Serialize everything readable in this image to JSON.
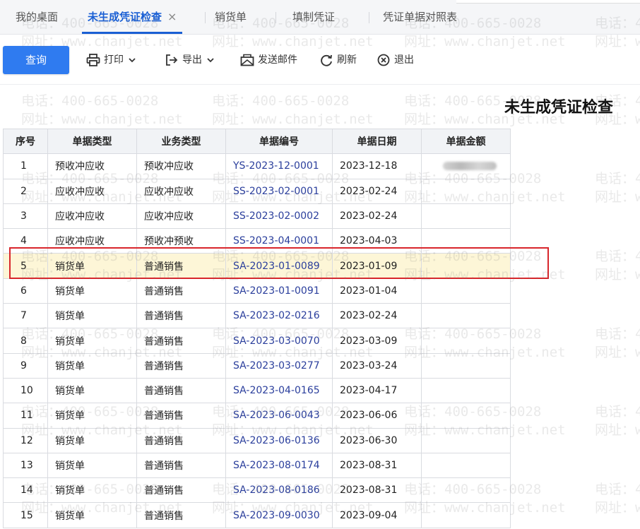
{
  "tabs": [
    {
      "label": "我的桌面"
    },
    {
      "label": "未生成凭证检查",
      "close": "×"
    },
    {
      "label": "销货单"
    },
    {
      "label": "填制凭证"
    },
    {
      "label": "凭证单据对照表"
    }
  ],
  "toolbar": {
    "query": "查询",
    "print": "打印",
    "export": "导出",
    "email": "发送邮件",
    "refresh": "刷新",
    "exit": "退出"
  },
  "page_title": "未生成凭证检查",
  "table": {
    "columns": [
      "序号",
      "单据类型",
      "业务类型",
      "单据编号",
      "单据日期",
      "单据金额"
    ],
    "rows": [
      {
        "seq": "1",
        "doc_type": "预收冲应收",
        "biz_type": "预收冲应收",
        "doc_no": "YS-2023-12-0001",
        "date": "2023-12-18",
        "amount": ""
      },
      {
        "seq": "2",
        "doc_type": "应收冲应收",
        "biz_type": "应收冲应收",
        "doc_no": "SS-2023-02-0001",
        "date": "2023-02-24",
        "amount": ""
      },
      {
        "seq": "3",
        "doc_type": "应收冲应收",
        "biz_type": "应收冲应收",
        "doc_no": "SS-2023-02-0002",
        "date": "2023-02-24",
        "amount": ""
      },
      {
        "seq": "4",
        "doc_type": "应收冲应收",
        "biz_type": "预收冲预收",
        "doc_no": "SS-2023-04-0001",
        "date": "2023-04-03",
        "amount": ""
      },
      {
        "seq": "5",
        "doc_type": "销货单",
        "biz_type": "普通销售",
        "doc_no": "SA-2023-01-0089",
        "date": "2023-01-09",
        "amount": ""
      },
      {
        "seq": "6",
        "doc_type": "销货单",
        "biz_type": "普通销售",
        "doc_no": "SA-2023-01-0091",
        "date": "2023-01-04",
        "amount": ""
      },
      {
        "seq": "7",
        "doc_type": "销货单",
        "biz_type": "普通销售",
        "doc_no": "SA-2023-02-0216",
        "date": "2023-02-24",
        "amount": ""
      },
      {
        "seq": "8",
        "doc_type": "销货单",
        "biz_type": "普通销售",
        "doc_no": "SA-2023-03-0070",
        "date": "2023-03-09",
        "amount": ""
      },
      {
        "seq": "9",
        "doc_type": "销货单",
        "biz_type": "普通销售",
        "doc_no": "SA-2023-03-0277",
        "date": "2023-03-24",
        "amount": ""
      },
      {
        "seq": "10",
        "doc_type": "销货单",
        "biz_type": "普通销售",
        "doc_no": "SA-2023-04-0165",
        "date": "2023-04-17",
        "amount": ""
      },
      {
        "seq": "11",
        "doc_type": "销货单",
        "biz_type": "普通销售",
        "doc_no": "SA-2023-06-0043",
        "date": "2023-06-06",
        "amount": ""
      },
      {
        "seq": "12",
        "doc_type": "销货单",
        "biz_type": "普通销售",
        "doc_no": "SA-2023-06-0136",
        "date": "2023-06-30",
        "amount": ""
      },
      {
        "seq": "13",
        "doc_type": "销货单",
        "biz_type": "普通销售",
        "doc_no": "SA-2023-08-0174",
        "date": "2023-08-31",
        "amount": ""
      },
      {
        "seq": "14",
        "doc_type": "销货单",
        "biz_type": "普通销售",
        "doc_no": "SA-2023-08-0186",
        "date": "2023-08-31",
        "amount": ""
      },
      {
        "seq": "15",
        "doc_type": "销货单",
        "biz_type": "普通销售",
        "doc_no": "SA-2023-09-0030",
        "date": "2023-09-04",
        "amount": ""
      }
    ]
  },
  "watermark": {
    "phone": "电话：400-665-0028",
    "site": "网址：www.chanjet.net"
  },
  "colors": {
    "accent": "#1a5fd4",
    "query_button": "#2f7bf0",
    "doc_no_text": "#2a3e9c",
    "highlight_row": "#fdf6d7",
    "highlight_border": "#d8262b"
  }
}
